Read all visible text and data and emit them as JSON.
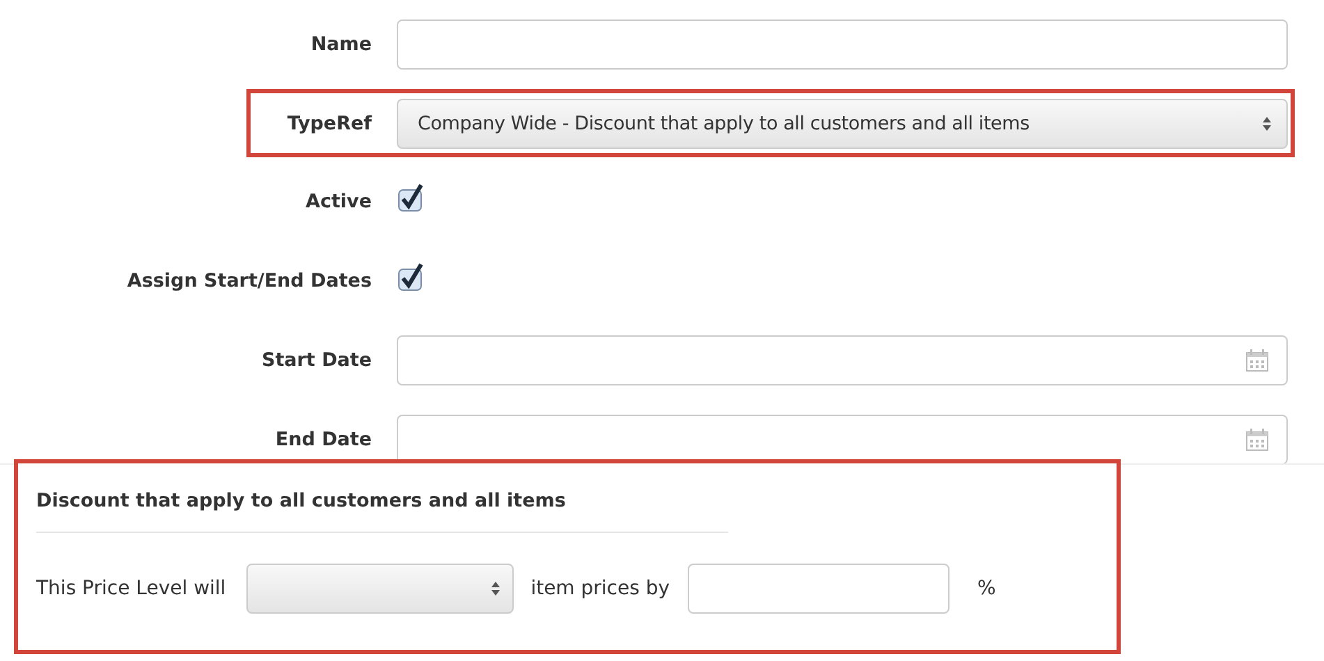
{
  "fields": [
    {
      "kind": "text",
      "label": "Name"
    },
    {
      "kind": "select",
      "label": "TypeRef",
      "value": "Company Wide - Discount that apply to all customers and all items",
      "highlighted": true
    },
    {
      "kind": "checkbox",
      "label": "Active",
      "checked": true
    },
    {
      "kind": "checkbox",
      "label": "Assign Start/End Dates",
      "checked": true
    },
    {
      "kind": "date",
      "label": "Start Date"
    },
    {
      "kind": "date",
      "label": "End Date"
    }
  ],
  "discount": {
    "highlighted": true,
    "title": "Discount that apply to all customers and all items",
    "prefix": "This Price Level will",
    "middle": "item prices by",
    "suffix": "%"
  }
}
